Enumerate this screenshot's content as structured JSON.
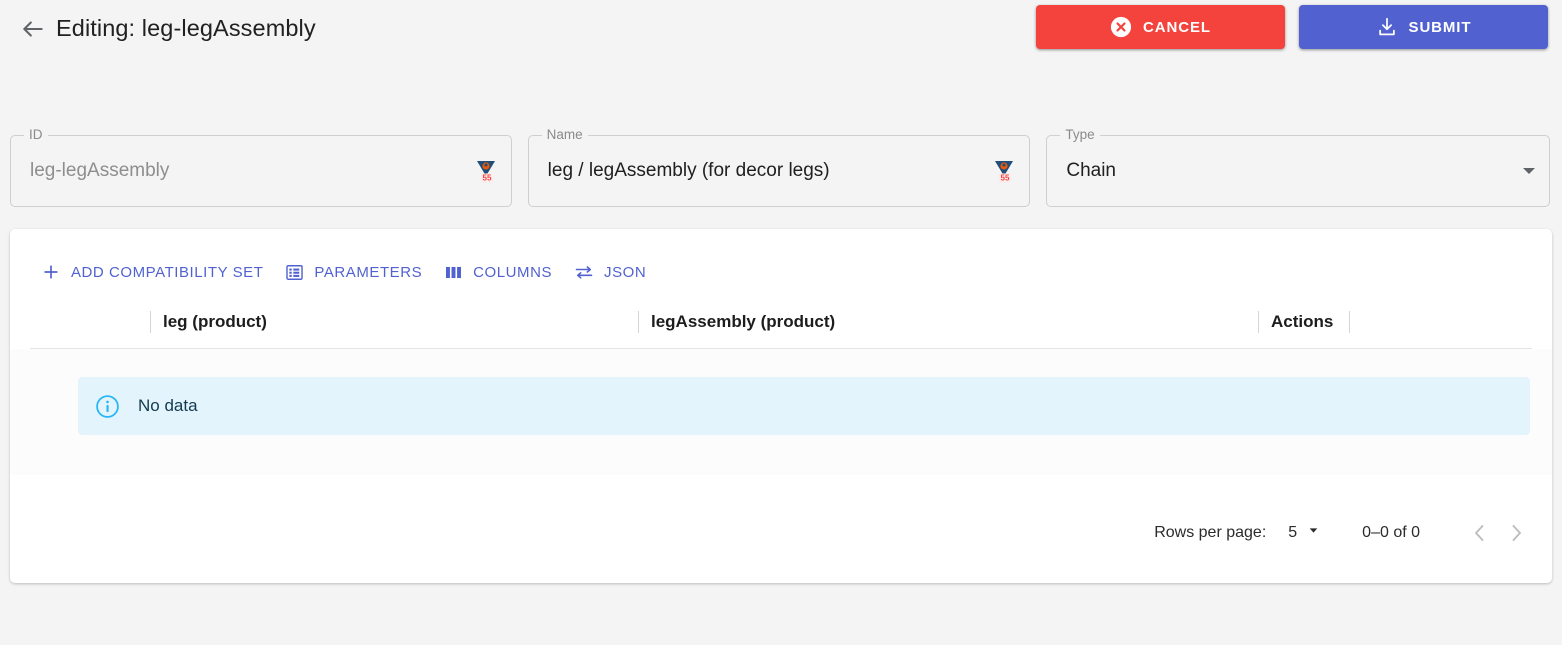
{
  "header": {
    "back_icon": "arrow-back-icon",
    "title": "Editing: leg-legAssembly",
    "cancel_label": "CANCEL",
    "cancel_icon": "cancel-circle-icon",
    "cancel_color": "#f4433c",
    "submit_label": "SUBMIT",
    "submit_icon": "save-download-icon",
    "submit_color": "#5162d0"
  },
  "form": {
    "id": {
      "label": "ID",
      "value": "leg-legAssembly",
      "disabled": true,
      "adornment_icon": "translate-badge-icon"
    },
    "name": {
      "label": "Name",
      "value": "leg / legAssembly (for decor legs)",
      "disabled": false,
      "adornment_icon": "translate-badge-icon"
    },
    "type": {
      "label": "Type",
      "value": "Chain",
      "dropdown_icon": "chevron-down-icon"
    }
  },
  "card": {
    "toolbar": [
      {
        "label": "ADD COMPATIBILITY SET",
        "icon": "plus-icon"
      },
      {
        "label": "PARAMETERS",
        "icon": "list-box-icon"
      },
      {
        "label": "COLUMNS",
        "icon": "columns-icon"
      },
      {
        "label": "JSON",
        "icon": "compare-arrows-icon"
      }
    ],
    "table": {
      "columns": [
        "leg (product)",
        "legAssembly (product)",
        "Actions"
      ],
      "rows": [],
      "empty_state": {
        "icon": "info-circle-icon",
        "text": "No data",
        "background": "#e4f4fd"
      }
    },
    "pagination": {
      "rows_per_page_label": "Rows per page:",
      "rows_per_page_value": "5",
      "range_label": "0–0 of 0",
      "prev_icon": "chevron-left-icon",
      "next_icon": "chevron-right-icon",
      "prev_disabled": true,
      "next_disabled": true
    }
  },
  "theme": {
    "accent": "#5162d0",
    "danger": "#f4433c",
    "page_bg": "#f4f4f4",
    "card_bg": "#ffffff",
    "info_bg": "#e4f4fd"
  }
}
